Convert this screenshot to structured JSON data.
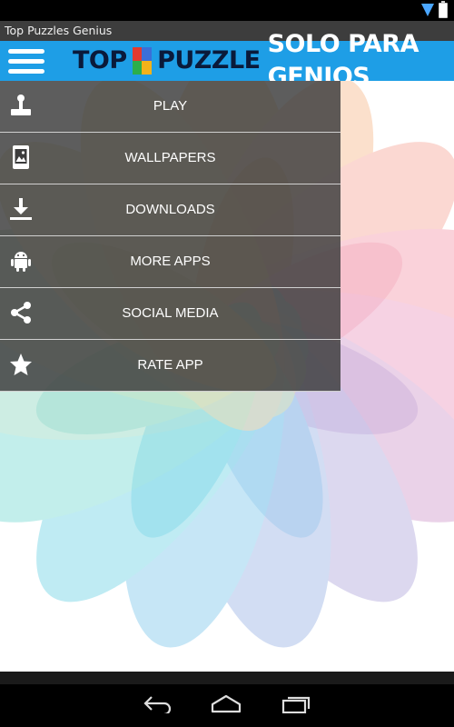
{
  "app": {
    "window_title": "Top Puzzles Genius"
  },
  "header": {
    "logo_word1": "TOP",
    "logo_word2": "PUZZLE",
    "logo_word3": "SOLO PARA GENIOS"
  },
  "menu": {
    "items": [
      {
        "label": "PLAY",
        "icon": "joystick-icon"
      },
      {
        "label": "WALLPAPERS",
        "icon": "wallpaper-icon"
      },
      {
        "label": "DOWNLOADS",
        "icon": "download-icon"
      },
      {
        "label": "MORE APPS",
        "icon": "android-icon"
      },
      {
        "label": "SOCIAL MEDIA",
        "icon": "share-icon"
      },
      {
        "label": "RATE APP",
        "icon": "star-icon"
      }
    ]
  },
  "colors": {
    "header_bg": "#1e9ee6",
    "menu_bg": "#3c3c3c",
    "title_bar_bg": "#3d3d3d"
  }
}
